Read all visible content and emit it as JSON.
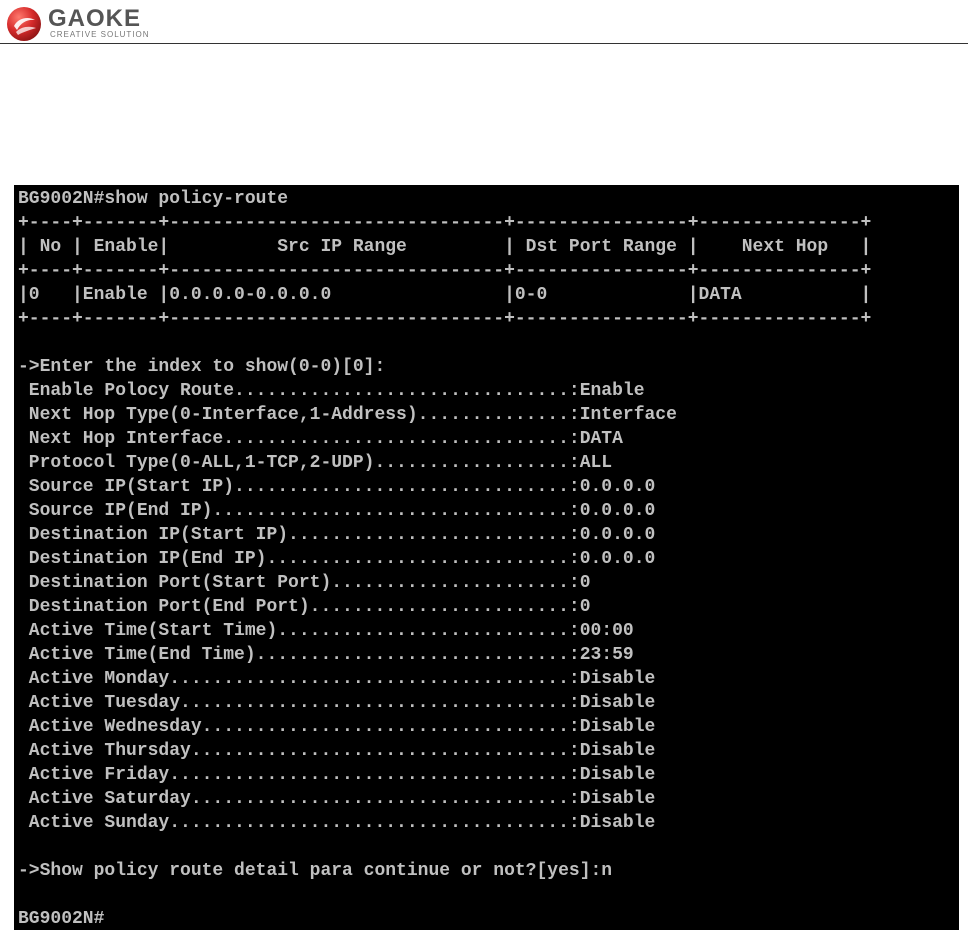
{
  "brand": {
    "name": "GAOKE",
    "tagline": "CREATIVE SOLUTION",
    "logo_icon": "red-sphere-logo-icon",
    "accent_color": "#d62b2b"
  },
  "terminal": {
    "background": "#000000",
    "text_color": "#c0c0c0",
    "lines": [
      "BG9002N#show policy-route",
      "+----+-------+-------------------------------+----------------+---------------+",
      "| No | Enable|          Src IP Range         | Dst Port Range |    Next Hop   |",
      "+----+-------+-------------------------------+----------------+---------------+",
      "|0   |Enable |0.0.0.0-0.0.0.0                |0-0             |DATA           |",
      "+----+-------+-------------------------------+----------------+---------------+",
      "",
      "->Enter the index to show(0-0)[0]:",
      " Enable Polocy Route...............................:Enable",
      " Next Hop Type(0-Interface,1-Address)..............:Interface",
      " Next Hop Interface................................:DATA",
      " Protocol Type(0-ALL,1-TCP,2-UDP)..................:ALL",
      " Source IP(Start IP)...............................:0.0.0.0",
      " Source IP(End IP).................................:0.0.0.0",
      " Destination IP(Start IP)..........................:0.0.0.0",
      " Destination IP(End IP)............................:0.0.0.0",
      " Destination Port(Start Port)......................:0",
      " Destination Port(End Port)........................:0",
      " Active Time(Start Time)...........................:00:00",
      " Active Time(End Time).............................:23:59",
      " Active Monday.....................................:Disable",
      " Active Tuesday....................................:Disable",
      " Active Wednesday..................................:Disable",
      " Active Thursday...................................:Disable",
      " Active Friday.....................................:Disable",
      " Active Saturday...................................:Disable",
      " Active Sunday.....................................:Disable",
      "",
      "->Show policy route detail para continue or not?[yes]:n",
      "",
      "BG9002N#"
    ]
  }
}
